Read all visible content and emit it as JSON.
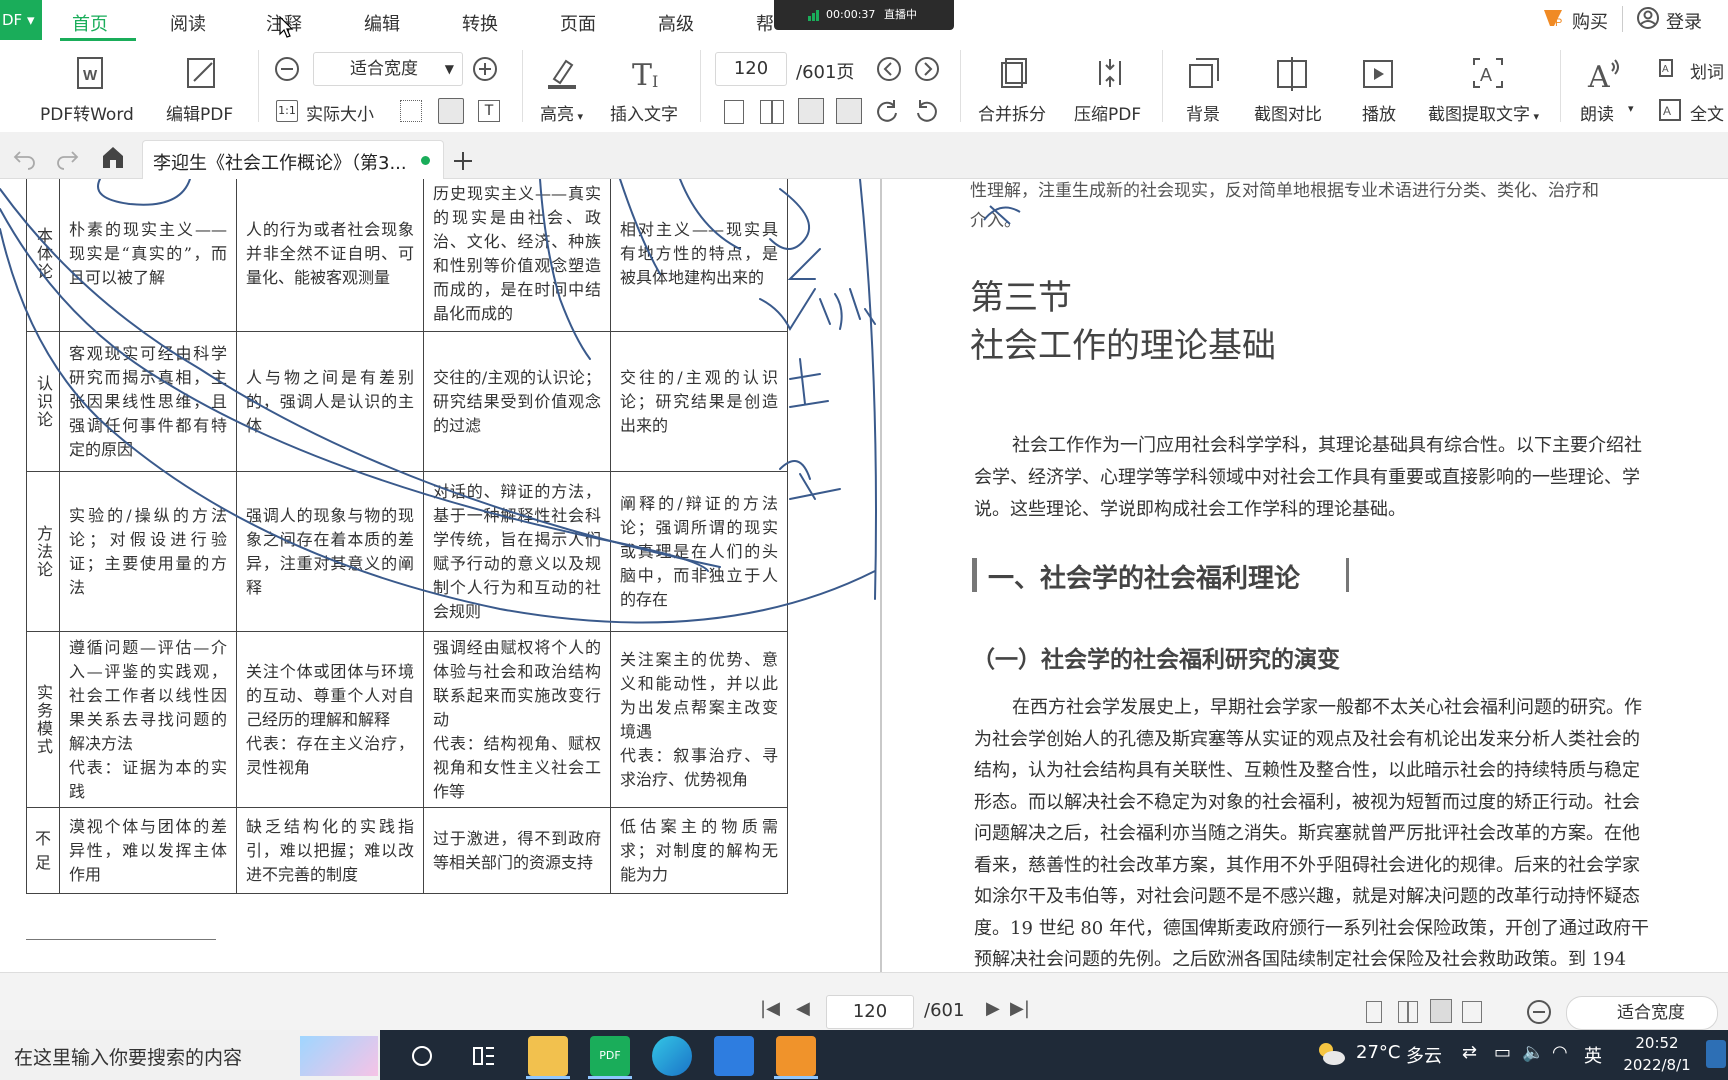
{
  "menu": {
    "logo": "DF",
    "items": [
      "首页",
      "阅读",
      "注释",
      "编辑",
      "转换",
      "页面",
      "高级",
      "帮"
    ],
    "active": "首页",
    "buy": "购买",
    "login": "登录"
  },
  "live": {
    "time": "00:00:37",
    "status": "直播中"
  },
  "ribbon": {
    "pdf_to_word": "PDF转Word",
    "edit_pdf": "编辑PDF",
    "zoom_value": "适合宽度",
    "actual_size": "实际大小",
    "highlight": "高亮",
    "insert_text": "插入文字",
    "page_current": "120",
    "page_total": "/601页",
    "merge_split": "合并拆分",
    "compress": "压缩PDF",
    "background": "背景",
    "screenshot_compare": "截图对比",
    "play": "播放",
    "extract_text": "截图提取文字",
    "read_aloud": "朗读",
    "word_lookup": "划词",
    "full_text": "全文"
  },
  "tab": {
    "title": "李迎生《社会工作概论》（第3..."
  },
  "table": {
    "rows": [
      {
        "head": "本体论",
        "cells": [
          "朴素的现实主义——现实是“真实的”，而且可以被了解",
          "人的行为或者社会现象并非全然不证自明、可量化、能被客观测量",
          "历史现实主义——真实的现实是由社会、政治、文化、经济、种族和性别等价值观念塑造而成的，是在时间中结晶化而成的",
          "相对主义——现实具有地方性的特点，是被具体地建构出来的"
        ]
      },
      {
        "head": "认识论",
        "cells": [
          "客观现实可经由科学研究而揭示真相，主张因果线性思维，且强调任何事件都有特定的原因",
          "人与物之间是有差别的，强调人是认识的主体",
          "交往的/主观的认识论；研究结果受到价值观念的过滤",
          "交往的/主观的认识论；研究结果是创造出来的"
        ]
      },
      {
        "head": "方法论",
        "cells": [
          "实验的/操纵的方法论；对假设进行验证；主要使用量的方法",
          "强调人的现象与物的现象之间存在着本质的差异，注重对其意义的阐释",
          "对话的、辩证的方法，基于一种解释性社会科学传统，旨在揭示人们赋予行动的意义以及规制个人行为和互动的社会规则",
          "阐释的/辩证的方法论；强调所谓的现实或真理是在人们的头脑中，而非独立于人的存在"
        ]
      },
      {
        "head": "实务模式",
        "cells": [
          "遵循问题—评估—介入—评鉴的实践观，社会工作者以线性因果关系去寻找问题的解决方法\n代表：证据为本的实践",
          "关注个体或团体与环境的互动、尊重个人对自己经历的理解和解释\n代表：存在主义治疗，灵性视角",
          "强调经由赋权将个人的体验与社会和政治结构联系起来而实施改变行动\n代表：结构视角、赋权视角和女性主义社会工作等",
          "关注案主的优势、意义和能动性，并以此为出发点帮案主改变境遇\n代表：叙事治疗、寻求治疗、优势视角"
        ]
      },
      {
        "head": "不足",
        "cells": [
          "漠视个体与团体的差异性，难以发挥主体作用",
          "缺乏结构化的实践指引，难以把握；难以改进不完善的制度",
          "过于激进，得不到政府等相关部门的资源支持",
          "低估案主的物质需求；对制度的解构无能为力"
        ]
      }
    ]
  },
  "right_page": {
    "top_line1": "性理解，注重生成新的社会现实，反对简单地根据专业术语进行分类、类化、治疗和",
    "top_line2": "介入。",
    "section_no": "第三节",
    "section_title": "社会工作的理论基础",
    "intro": [
      "社会工作作为一门应用社会科学学科，其理论基础具有综合性。以下主要介绍社",
      "会学、经济学、心理学等学科领域中对社会工作具有重要或直接影响的一些理论、学",
      "说。这些理论、学说即构成社会工作学科的理论基础。"
    ],
    "h1": "一、社会学的社会福利理论",
    "h2": "（一）社会学的社会福利研究的演变",
    "body": [
      "在西方社会学发展史上，早期社会学家一般都不太关心社会福利问题的研究。作",
      "为社会学创始人的孔德及斯宾塞等从实证的观点及社会有机论出发来分析人类社会的",
      "结构，认为社会结构具有关联性、互赖性及整合性，以此暗示社会的持续特质与稳定",
      "形态。而以解决社会不稳定为对象的社会福利，被视为短暂而过度的矫正行动。社会",
      "问题解决之后，社会福利亦当随之消失。斯宾塞就曾严厉批评社会改革的方案。在他",
      "看来，慈善性的社会改革方案，其作用不外乎阻碍社会进化的规律。后来的社会学家",
      "如涂尔干及韦伯等，对社会问题不是不感兴趣，就是对解决问题的改革行动持怀疑态",
      "度。19 世纪 80 年代，德国俾斯麦政府颁行一系列社会保险政策，开创了通过政府干",
      "预解决社会问题的先例。之后欧洲各国陆续制定社会保险及社会救助政策。到 194"
    ]
  },
  "nav": {
    "page": "120",
    "total": "/601",
    "zoom": "适合宽度"
  },
  "taskbar": {
    "search_placeholder": "在这里输入你要搜索的内容",
    "weather_temp": "27°C",
    "weather_text": "多云",
    "ime": "英",
    "time": "20:52",
    "date": "2022/8/1"
  },
  "colors": {
    "accent": "#1aad5a",
    "ink": "#3a5a8c",
    "taskbar": "#1f2a38"
  }
}
